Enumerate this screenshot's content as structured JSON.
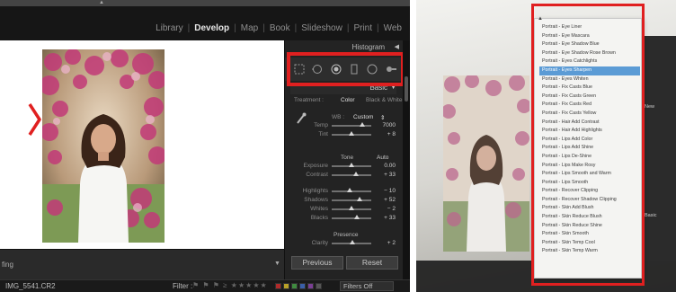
{
  "lightroom": {
    "modules": [
      {
        "label": "Library",
        "active": false
      },
      {
        "label": "Develop",
        "active": true
      },
      {
        "label": "Map",
        "active": false
      },
      {
        "label": "Book",
        "active": false
      },
      {
        "label": "Slideshow",
        "active": false
      },
      {
        "label": "Print",
        "active": false
      },
      {
        "label": "Web",
        "active": false
      }
    ],
    "panel": {
      "histogram_title": "Histogram",
      "tools": [
        "crop-overlay-icon",
        "spot-removal-icon",
        "red-eye-icon",
        "graduated-filter-icon",
        "radial-filter-icon",
        "adjustment-brush-icon"
      ],
      "basic_title": "Basic",
      "treatment_label": "Treatment :",
      "treatment_color": "Color",
      "treatment_bw": "Black & White",
      "wb_label": "WB :",
      "wb_value": "Custom",
      "temp_label": "Temp",
      "temp_value": "7000",
      "tint_label": "Tint",
      "tint_value": "+ 8",
      "tone_title": "Tone",
      "tone_auto": "Auto",
      "exposure_label": "Exposure",
      "exposure_value": "0.00",
      "contrast_label": "Contrast",
      "contrast_value": "+ 33",
      "highlights_label": "Highlights",
      "highlights_value": "− 10",
      "shadows_label": "Shadows",
      "shadows_value": "+ 52",
      "whites_label": "Whites",
      "whites_value": "− 2",
      "blacks_label": "Blacks",
      "blacks_value": "+ 33",
      "presence_title": "Presence",
      "clarity_label": "Clarity",
      "clarity_value": "+ 2",
      "previous_button": "Previous",
      "reset_button": "Reset"
    },
    "toolbar_text": "fing",
    "status": {
      "filename": "IMG_5541.CR2",
      "filter_label": "Filter :",
      "filters_off": "Filters Off"
    },
    "accent_color": "#e02020"
  },
  "dropdown": {
    "items": [
      "Portrait - Eye Liner",
      "Portrait - Eye Mascara",
      "Portrait - Eye Shadow Blue",
      "Portrait - Eye Shadow Rose Brown",
      "Portrait - Eyes Catchlights",
      "Portrait - Eyes Sharpen",
      "Portrait - Eyes Whiten",
      "Portrait - Fix Casts Blue",
      "Portrait - Fix Casts Green",
      "Portrait - Fix Casts Red",
      "Portrait - Fix Casts Yellow",
      "Portrait - Hair Add Contrast",
      "Portrait - Hair Add Highlights",
      "Portrait - Lips Add Color",
      "Portrait - Lips Add Shine",
      "Portrait - Lips De-Shine",
      "Portrait - Lips Make Rosy",
      "Portrait - Lips Smooth and Warm",
      "Portrait - Lips Smooth",
      "Portrait - Recover Clipping",
      "Portrait - Recover Shadow Clipping",
      "Portrait - Skin Add Blush",
      "Portrait - Skin Reduce Blush",
      "Portrait - Skin Reduce Shine",
      "Portrait - Skin Smooth",
      "Portrait - Skin Temp Cool",
      "Portrait - Skin Temp Warm"
    ],
    "selected_index": 5
  },
  "right_panel_labels": {
    "new_label": "New",
    "basic_label": "Basic"
  }
}
